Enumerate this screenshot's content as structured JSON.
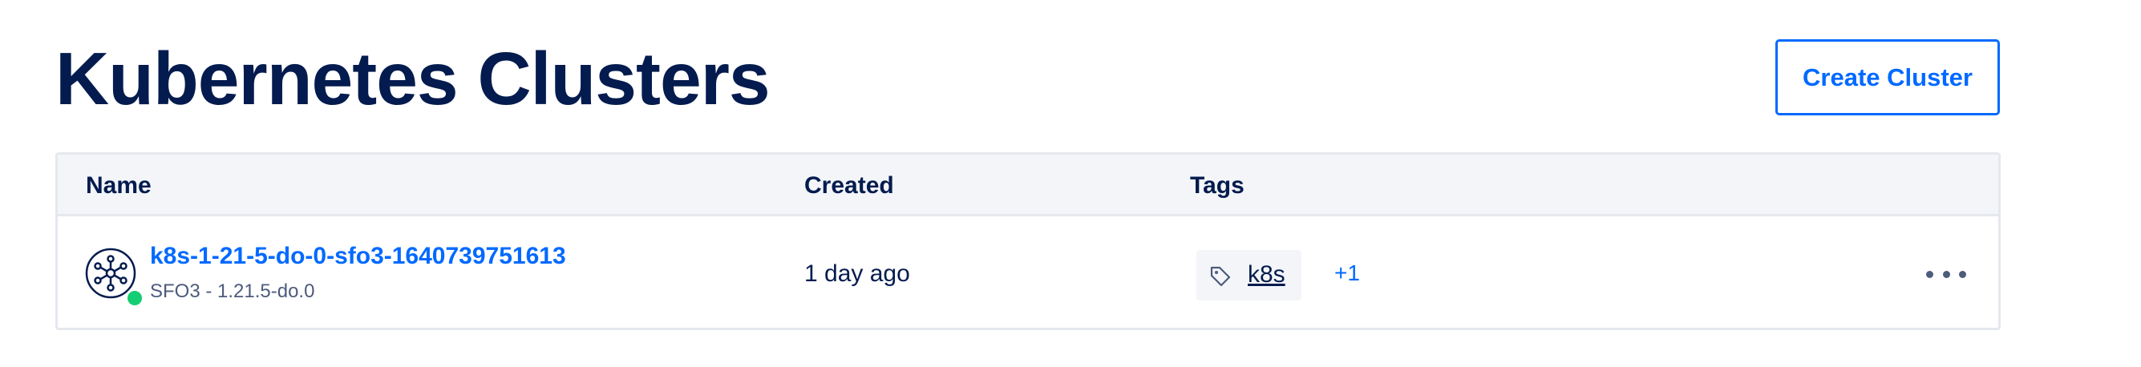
{
  "page": {
    "title": "Kubernetes Clusters",
    "create_button_label": "Create Cluster"
  },
  "table": {
    "columns": [
      "Name",
      "Created",
      "Tags"
    ],
    "rows": [
      {
        "name": "k8s-1-21-5-do-0-sfo3-1640739751613",
        "meta": "SFO3 - 1.21.5-do.0",
        "status": "running",
        "status_color": "#15cd72",
        "icon": "kubernetes-cluster-icon",
        "created": "1 day ago",
        "tag": "k8s",
        "tag_icon": "tag-icon",
        "more_tags": "+1",
        "actions_icon": "more-options-icon"
      }
    ]
  },
  "colors": {
    "accent": "#0069ff",
    "text_primary": "#031b4e",
    "text_secondary": "#4d5b7c",
    "header_bg": "#f3f5f9",
    "border": "#e5e8ed"
  }
}
